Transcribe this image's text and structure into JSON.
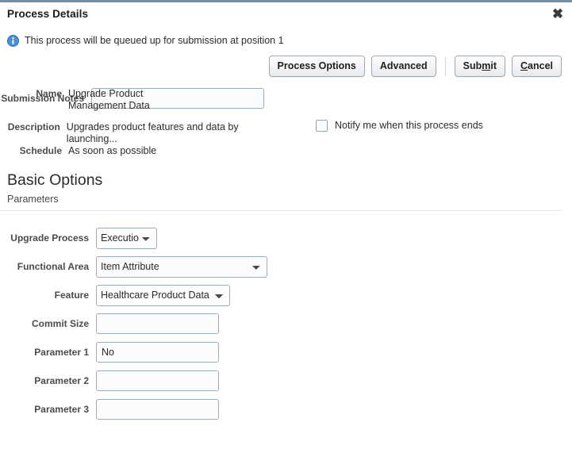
{
  "dialog": {
    "title": "Process Details",
    "close_icon": "close-icon",
    "accent_color": "#7a8ca0",
    "info": {
      "icon": "info-icon",
      "message": "This process will be queued up for submission at position 1"
    }
  },
  "actions": {
    "process_options": "Process Options",
    "advanced": "Advanced",
    "submit_pre": "Sub",
    "submit_key": "m",
    "submit_post": "it",
    "cancel_key": "C",
    "cancel_post": "ancel"
  },
  "summary": {
    "name_label": "Name",
    "name_value": "Upgrade Product Management Data",
    "description_label": "Description",
    "description_value": "Upgrades product features and data by launching...",
    "schedule_label": "Schedule",
    "schedule_value": "As soon as possible",
    "notify_label": "Notify me when this process ends",
    "notify_checked": false,
    "submission_notes_label": "Submission Notes",
    "submission_notes_value": "",
    "submission_notes_placeholder": ""
  },
  "section": {
    "title": "Basic Options",
    "subtitle": "Parameters"
  },
  "parameters": [
    {
      "label": "Upgrade Process",
      "type": "select",
      "value": "Execution",
      "class": "sel-upgrade",
      "name": "upgrade-process-select"
    },
    {
      "label": "Functional Area",
      "type": "select",
      "value": "Item Attribute",
      "class": "sel-area",
      "name": "functional-area-select"
    },
    {
      "label": "Feature",
      "type": "select",
      "value": "Healthcare Product Data",
      "class": "sel-feature",
      "name": "feature-select"
    },
    {
      "label": "Commit Size",
      "type": "text",
      "value": "",
      "class": "txt-param",
      "name": "commit-size-input"
    },
    {
      "label": "Parameter 1",
      "type": "text",
      "value": "No",
      "class": "txt-param",
      "name": "parameter-1-input"
    },
    {
      "label": "Parameter 2",
      "type": "text",
      "value": "",
      "class": "txt-param",
      "name": "parameter-2-input"
    },
    {
      "label": "Parameter 3",
      "type": "text",
      "value": "",
      "class": "txt-param",
      "name": "parameter-3-input"
    }
  ]
}
